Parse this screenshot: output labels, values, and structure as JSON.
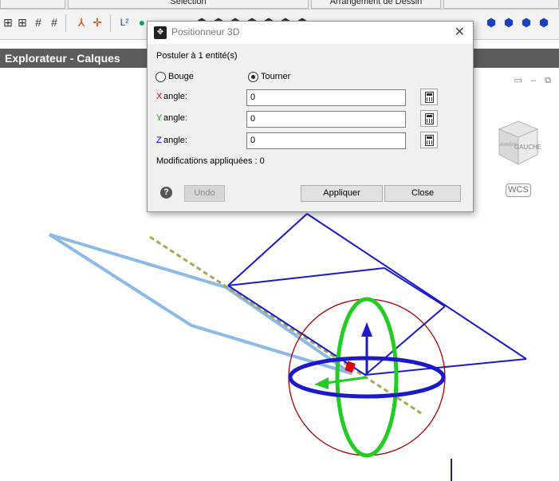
{
  "tabs": [
    {
      "label": ""
    },
    {
      "label": "Sélection"
    },
    {
      "label": "Arrangement de Dessin"
    },
    {
      "label": ""
    }
  ],
  "panel": {
    "title": "Explorateur - Calques"
  },
  "viewcube": {
    "face_label": "GAUCHE",
    "side_label": "ARRIÈRE",
    "wcs_label": "WCS"
  },
  "dialog": {
    "title": "Positionneur 3D",
    "subtitle": "Postuler à 1 entité(s)",
    "mode_options": [
      {
        "label": "Bouge",
        "selected": false
      },
      {
        "label": "Tourner",
        "selected": true
      }
    ],
    "angles": [
      {
        "axis": "X",
        "label": " angle:",
        "value": "0",
        "color": "#e00000"
      },
      {
        "axis": "Y",
        "label": " angle:",
        "value": "0",
        "color": "#00b000"
      },
      {
        "axis": "Z",
        "label": " angle:",
        "value": "0",
        "color": "#0000e0"
      }
    ],
    "status": "Modifications appliquées : 0",
    "buttons": {
      "undo": "Undo",
      "apply": "Appliquer",
      "close": "Close"
    }
  },
  "colors": {
    "panel_bar": "#5c5c5c",
    "wire_blue": "#1a1acc",
    "highlight_plane": "#7fb2e5",
    "gizmo_green": "#22cc22",
    "gizmo_red": "#aa0000"
  }
}
